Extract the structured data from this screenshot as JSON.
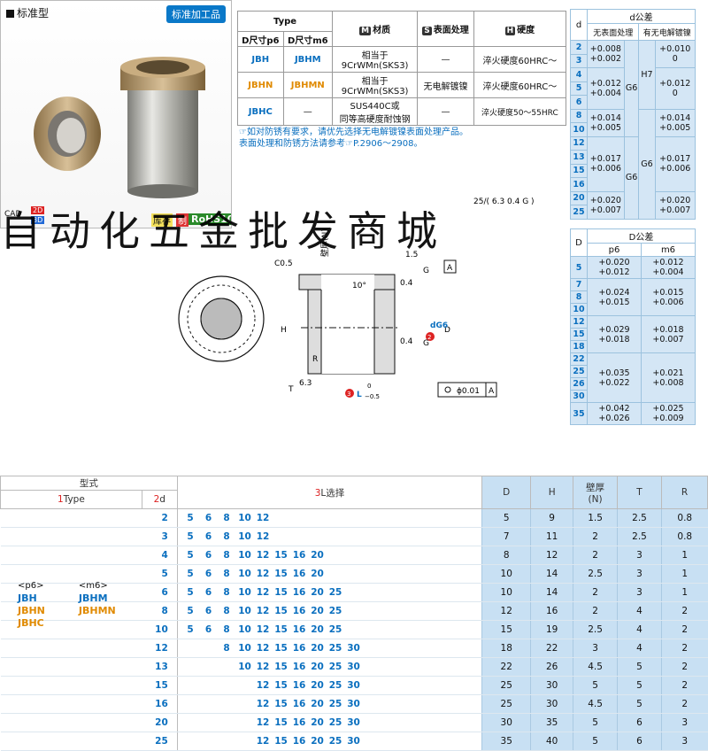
{
  "panel": {
    "std_label": "标准型",
    "badge": "标准加工品",
    "cad": "CAD",
    "b2d": "2D",
    "b3d": "3D",
    "stock_label": "库存",
    "stock_icon": "制",
    "rohs": "RoHS10"
  },
  "type_table": {
    "type_header": "Type",
    "m_header": "材质",
    "s_header": "表面处理",
    "h_header": "硬度",
    "m_tag": "M",
    "s_tag": "S",
    "h_tag": "H",
    "p6_header": "D尺寸p6",
    "m6_header": "D尺寸m6",
    "rows": [
      {
        "p6": "JBH",
        "m6": "JBHM",
        "material1": "相当于",
        "material2": "9CrWMn(SKS3)",
        "surface": "—",
        "hardness": "淬火硬度60HRC～"
      },
      {
        "p6": "JBHN",
        "m6": "JBHMN",
        "material1": "相当于",
        "material2": "9CrWMn(SKS3)",
        "surface": "无电解镀镍",
        "hardness": "淬火硬度60HRC～"
      },
      {
        "p6": "JBHC",
        "m6": "—",
        "material1": "SUS440C或",
        "material2": "同等高硬度耐蚀钢",
        "surface": "—",
        "hardness": "淬火硬度50～55HRC"
      }
    ]
  },
  "notes": {
    "line1": "☞如对防锈有要求，请优先选择无电解镀镍表面处理产品。",
    "line2": "表面处理和防锈方法请参考☞P.2906～2908。"
  },
  "tol1": {
    "d_header": "d",
    "tol_header": "d公差",
    "col1": "无表面处理",
    "col2": "有无电解镀镍",
    "g6": "G6",
    "h7": "H7",
    "rows": [
      {
        "d": "2",
        "a": "+0.008",
        "b": "+0.002",
        "c": "+0.010",
        "e": "0"
      },
      {
        "d": "3"
      },
      {
        "d": "4",
        "a": "+0.012",
        "b": "+0.004",
        "c": "+0.012",
        "e": "0"
      },
      {
        "d": "5"
      },
      {
        "d": "6"
      },
      {
        "d": "8",
        "a": "+0.014",
        "b": "+0.005",
        "c": "+0.014",
        "e": "+0.005"
      },
      {
        "d": "10"
      },
      {
        "d": "12",
        "a": "+0.017",
        "b": "+0.006",
        "c": "+0.017",
        "e": "+0.006"
      },
      {
        "d": "13"
      },
      {
        "d": "15"
      },
      {
        "d": "16"
      },
      {
        "d": "20",
        "a": "+0.020",
        "b": "+0.007",
        "c": "+0.020",
        "e": "+0.007"
      },
      {
        "d": "25"
      }
    ]
  },
  "tol2": {
    "d_header": "D",
    "tol_header": "D公差",
    "p6": "p6",
    "m6": "m6",
    "rows": [
      {
        "d": [
          "5"
        ],
        "p1": "+0.020",
        "p2": "+0.012",
        "m1": "+0.012",
        "m2": "+0.004"
      },
      {
        "d": [
          "7",
          "8",
          "10"
        ],
        "p1": "+0.024",
        "p2": "+0.015",
        "m1": "+0.015",
        "m2": "+0.006"
      },
      {
        "d": [
          "12",
          "15",
          "18"
        ],
        "p1": "+0.029",
        "p2": "+0.018",
        "m1": "+0.018",
        "m2": "+0.007"
      },
      {
        "d": [
          "22",
          "25",
          "26",
          "30"
        ],
        "p1": "+0.035",
        "p2": "+0.022",
        "m1": "+0.021",
        "m2": "+0.008"
      },
      {
        "d": [
          "35"
        ],
        "p1": "+0.042",
        "p2": "+0.026",
        "m1": "+0.025",
        "m2": "+0.009"
      }
    ]
  },
  "drawing": {
    "c05": "C0.5",
    "wall": "壁厚(N)",
    "dim15": "1.5",
    "angle": "10°",
    "g": "G",
    "a": "A",
    "ra04": "0.4",
    "h": "H",
    "d": "D",
    "dg6": "dG6",
    "r": "R",
    "ra63": "6.3",
    "t": "T",
    "l": "L",
    "l_tol_top": "0",
    "l_tol_bot": "−0.5",
    "circle2": "2",
    "circle3": "3",
    "concentric": "ϕ0.01",
    "rough_note": "25/( 6.3 0.4 G )"
  },
  "watermark": "自动化五金批发商城",
  "bottom": {
    "model_header": "型式",
    "type_header": "Type",
    "d_header": "d",
    "l_header": "L选择",
    "circle1": "1",
    "circle2": "2",
    "circle3": "3",
    "D": "D",
    "H": "H",
    "wall1": "壁厚",
    "wall2": "(N)",
    "T": "T",
    "R": "R",
    "p6_label": "<p6>",
    "m6_label": "<m6>",
    "types_p6": [
      "JBH",
      "JBHN",
      "JBHC"
    ],
    "types_m6": [
      "JBHM",
      "JBHMN"
    ],
    "rows": [
      {
        "d": "2",
        "L": [
          "5",
          "6",
          "8",
          "10",
          "12",
          "",
          "",
          "",
          "",
          ""
        ],
        "D": "5",
        "H": "9",
        "N": "1.5",
        "T": "2.5",
        "R": "0.8"
      },
      {
        "d": "3",
        "L": [
          "5",
          "6",
          "8",
          "10",
          "12",
          "",
          "",
          "",
          "",
          ""
        ],
        "D": "7",
        "H": "11",
        "N": "2",
        "T": "2.5",
        "R": "0.8"
      },
      {
        "d": "4",
        "L": [
          "5",
          "6",
          "8",
          "10",
          "12",
          "15",
          "16",
          "20",
          "",
          ""
        ],
        "D": "8",
        "H": "12",
        "N": "2",
        "T": "3",
        "R": "1"
      },
      {
        "d": "5",
        "L": [
          "5",
          "6",
          "8",
          "10",
          "12",
          "15",
          "16",
          "20",
          "",
          ""
        ],
        "D": "10",
        "H": "14",
        "N": "2.5",
        "T": "3",
        "R": "1"
      },
      {
        "d": "6",
        "L": [
          "5",
          "6",
          "8",
          "10",
          "12",
          "15",
          "16",
          "20",
          "25",
          ""
        ],
        "D": "10",
        "H": "14",
        "N": "2",
        "T": "3",
        "R": "1"
      },
      {
        "d": "8",
        "L": [
          "5",
          "6",
          "8",
          "10",
          "12",
          "15",
          "16",
          "20",
          "25",
          ""
        ],
        "D": "12",
        "H": "16",
        "N": "2",
        "T": "4",
        "R": "2"
      },
      {
        "d": "10",
        "L": [
          "5",
          "6",
          "8",
          "10",
          "12",
          "15",
          "16",
          "20",
          "25",
          ""
        ],
        "D": "15",
        "H": "19",
        "N": "2.5",
        "T": "4",
        "R": "2"
      },
      {
        "d": "12",
        "L": [
          "",
          "",
          "8",
          "10",
          "12",
          "15",
          "16",
          "20",
          "25",
          "30"
        ],
        "D": "18",
        "H": "22",
        "N": "3",
        "T": "4",
        "R": "2"
      },
      {
        "d": "13",
        "L": [
          "",
          "",
          "",
          "10",
          "12",
          "15",
          "16",
          "20",
          "25",
          "30"
        ],
        "D": "22",
        "H": "26",
        "N": "4.5",
        "T": "5",
        "R": "2"
      },
      {
        "d": "15",
        "L": [
          "",
          "",
          "",
          "",
          "12",
          "15",
          "16",
          "20",
          "25",
          "30"
        ],
        "D": "25",
        "H": "30",
        "N": "5",
        "T": "5",
        "R": "2"
      },
      {
        "d": "16",
        "L": [
          "",
          "",
          "",
          "",
          "12",
          "15",
          "16",
          "20",
          "25",
          "30"
        ],
        "D": "25",
        "H": "30",
        "N": "4.5",
        "T": "5",
        "R": "2"
      },
      {
        "d": "20",
        "L": [
          "",
          "",
          "",
          "",
          "12",
          "15",
          "16",
          "20",
          "25",
          "30"
        ],
        "D": "30",
        "H": "35",
        "N": "5",
        "T": "6",
        "R": "3"
      },
      {
        "d": "25",
        "L": [
          "",
          "",
          "",
          "",
          "12",
          "15",
          "16",
          "20",
          "25",
          "30"
        ],
        "D": "35",
        "H": "40",
        "N": "5",
        "T": "6",
        "R": "3"
      }
    ]
  }
}
